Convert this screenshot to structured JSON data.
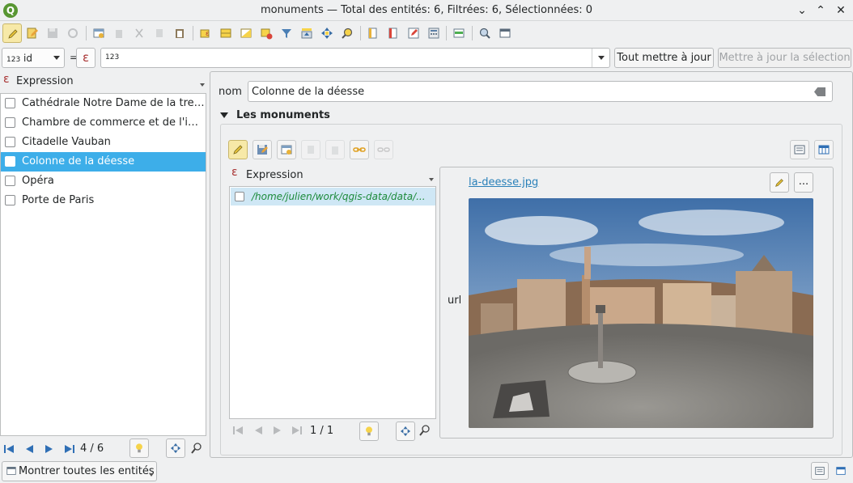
{
  "window": {
    "title": "monuments — Total des entités: 6, Filtrées: 6, Sélectionnées: 0",
    "app_logo_letter": "Q",
    "controls": {
      "minimize": "⌄",
      "maximize": "⌃",
      "close": "✕"
    }
  },
  "toolbar": {
    "icons": [
      "toggle-editing-icon",
      "multi-edit-icon",
      "save-edits-icon",
      "reload-icon",
      "add-feature-icon",
      "delete-feature-icon",
      "cut-icon",
      "copy-icon",
      "paste-icon",
      "select-by-expression-icon",
      "select-all-icon",
      "invert-selection-icon",
      "deselect-icon",
      "filter-icon",
      "move-selection-top-icon",
      "pan-to-selected-icon",
      "zoom-to-selected-icon",
      "new-field-icon",
      "delete-field-icon",
      "organize-columns-icon",
      "field-calculator-icon",
      "conditional-formatting-icon",
      "actions-icon",
      "dock-icon"
    ]
  },
  "expression_bar": {
    "field_type": "123",
    "field_name": "id",
    "equals": "=",
    "epsilon": "ε",
    "value_type": "123",
    "value": "",
    "update_all_label": "Tout mettre à jour",
    "update_selection_label": "Mettre à jour la sélection"
  },
  "left_panel": {
    "header": "Expression",
    "items": [
      {
        "label": "Cathédrale Notre Dame de la treille",
        "selected": false
      },
      {
        "label": "Chambre de commerce et de l'indu...",
        "selected": false
      },
      {
        "label": "Citadelle Vauban",
        "selected": false
      },
      {
        "label": "Colonne de la déesse",
        "selected": true
      },
      {
        "label": "Opéra",
        "selected": false
      },
      {
        "label": "Porte de Paris",
        "selected": false
      }
    ],
    "nav": {
      "position": "4 / 6"
    }
  },
  "form": {
    "nom_label": "nom",
    "nom_value": "Colonne de la déesse",
    "group_title": "Les monuments",
    "sub_header": "Expression",
    "sub_items": [
      {
        "label": "/home/julien/work/qgis-data/data/..."
      }
    ],
    "sub_nav": {
      "position": "1 / 1"
    },
    "url_label": "url",
    "url_link": "la-deesse.jpg",
    "more_button": "..."
  },
  "statusbar": {
    "filter_label": "Montrer toutes les entités"
  },
  "colors": {
    "selection": "#3daee9",
    "accent_yellow": "#f7e9a8",
    "link": "#2980b9",
    "path_text": "#1c8a3a"
  }
}
